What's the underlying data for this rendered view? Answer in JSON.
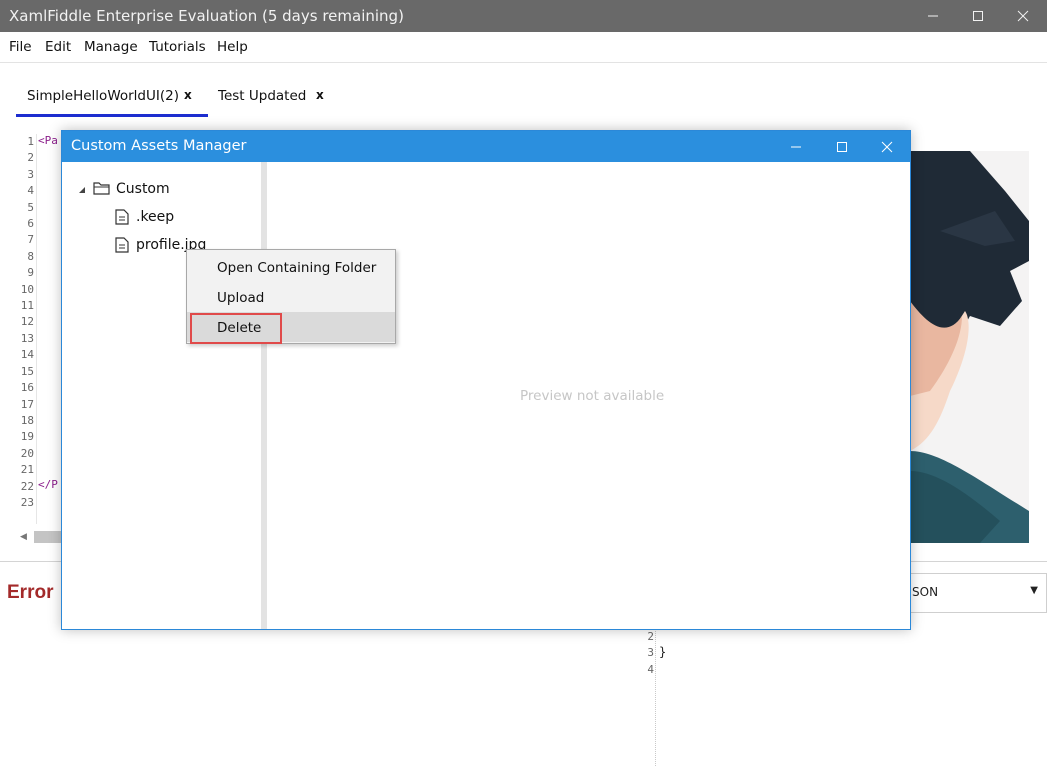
{
  "window": {
    "title": "XamlFiddle Enterprise Evaluation (5 days remaining)"
  },
  "menu": [
    "File",
    "Edit",
    "Manage",
    "Tutorials",
    "Help"
  ],
  "tabs": [
    {
      "label": "SimpleHelloWorldUI(2)",
      "close": "x",
      "active": true
    },
    {
      "label": "Test Updated",
      "close": "x",
      "active": false
    }
  ],
  "editor": {
    "line_numbers": [
      "1",
      "2",
      "3",
      "4",
      "5",
      "6",
      "7",
      "8",
      "9",
      "10",
      "11",
      "12",
      "13",
      "14",
      "15",
      "16",
      "17",
      "18",
      "19",
      "20",
      "21",
      "22",
      "23"
    ],
    "line1_snip": "<Pa",
    "line22_snip": "</P"
  },
  "error_panel": {
    "title": "Error",
    "combo_value": "SON",
    "lower_line_numbers": [
      "2",
      "3",
      "4"
    ],
    "brace": "}"
  },
  "dialog": {
    "title": "Custom Assets Manager",
    "tree": {
      "folder": "Custom",
      "files": [
        ".keep",
        "profile.jpg"
      ]
    },
    "preview_placeholder": "Preview not available"
  },
  "context_menu": {
    "items": [
      "Open Containing Folder",
      "Upload",
      "Delete"
    ],
    "highlighted": "Delete"
  },
  "colors": {
    "titlebar": "#696969",
    "dialog_titlebar": "#2b8fde",
    "tab_accent": "#1c2dcf",
    "error": "#a32a2a",
    "highlight_box": "#e04a4a"
  }
}
